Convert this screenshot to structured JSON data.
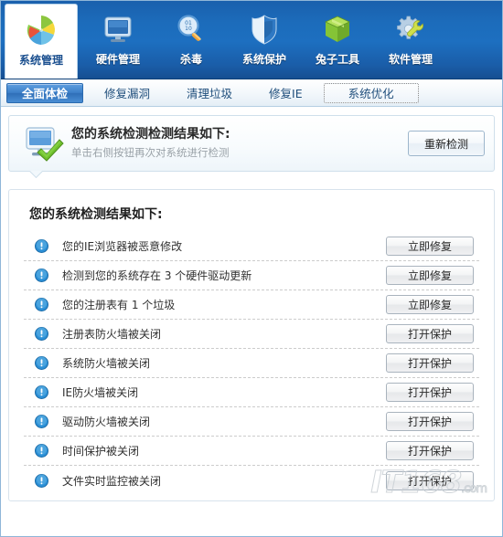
{
  "topnav": {
    "items": [
      {
        "label": "系统管理",
        "icon": "pie-chart-icon",
        "active": true
      },
      {
        "label": "硬件管理",
        "icon": "monitor-icon",
        "active": false
      },
      {
        "label": "杀毒",
        "icon": "magnifier-icon",
        "active": false
      },
      {
        "label": "系统保护",
        "icon": "shield-icon",
        "active": false
      },
      {
        "label": "兔子工具",
        "icon": "green-box-icon",
        "active": false
      },
      {
        "label": "软件管理",
        "icon": "gear-wrench-icon",
        "active": false
      }
    ]
  },
  "subtabs": {
    "items": [
      {
        "label": "全面体检",
        "state": "active"
      },
      {
        "label": "修复漏洞",
        "state": "normal"
      },
      {
        "label": "清理垃圾",
        "state": "normal"
      },
      {
        "label": "修复IE",
        "state": "normal"
      },
      {
        "label": "系统优化",
        "state": "focused"
      }
    ]
  },
  "info_panel": {
    "icon": "monitor-check-icon",
    "title": "您的系统检测检测结果如下:",
    "subtitle": "单击右侧按钮再次对系统进行检测",
    "button_label": "重新检测"
  },
  "results": {
    "heading": "您的系统检测结果如下:",
    "rows": [
      {
        "icon": "warning-icon",
        "label": "您的IE浏览器被恶意修改",
        "action": "立即修复"
      },
      {
        "icon": "warning-icon",
        "label": "检测到您的系统存在 3 个硬件驱动更新",
        "action": "立即修复"
      },
      {
        "icon": "warning-icon",
        "label": "您的注册表有 1 个垃圾",
        "action": "立即修复"
      },
      {
        "icon": "warning-icon",
        "label": "注册表防火墙被关闭",
        "action": "打开保护"
      },
      {
        "icon": "warning-icon",
        "label": "系统防火墙被关闭",
        "action": "打开保护"
      },
      {
        "icon": "warning-icon",
        "label": "IE防火墙被关闭",
        "action": "打开保护"
      },
      {
        "icon": "warning-icon",
        "label": "驱动防火墙被关闭",
        "action": "打开保护"
      },
      {
        "icon": "warning-icon",
        "label": "时间保护被关闭",
        "action": "打开保护"
      },
      {
        "icon": "warning-icon",
        "label": "文件实时监控被关闭",
        "action": "打开保护"
      }
    ]
  },
  "watermark": {
    "text": "IT168",
    "suffix": ".com"
  },
  "colors": {
    "header_blue": "#1c6cbb",
    "active_tab_blue": "#3c7fc8",
    "warning_blue": "#2b8fd6",
    "panel_border": "#cfdfeb"
  }
}
